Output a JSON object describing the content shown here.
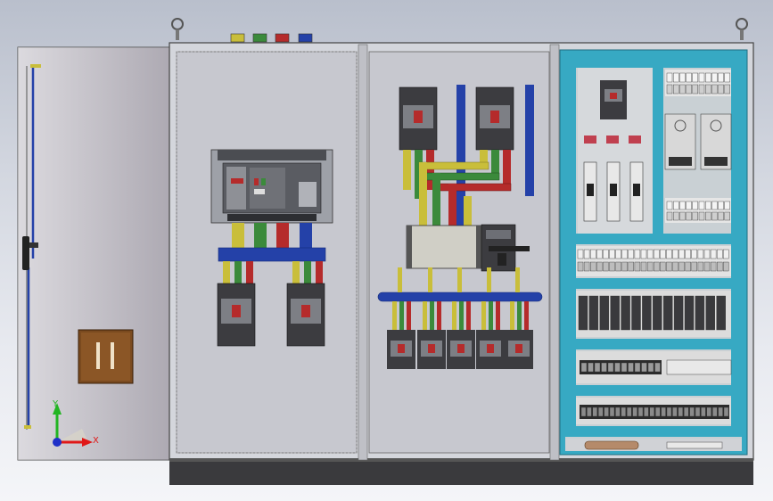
{
  "scene": {
    "breaker_label": "",
    "switch_label": "",
    "triad_labels": {
      "x": "X",
      "y": "Y"
    }
  },
  "colors": {
    "background_top": "#b9bfcc",
    "background_bottom": "#f4f5f8",
    "enclosure": "#d4d6dc",
    "panel": "#c7c8cf",
    "door": "#c4c1c9",
    "plinth": "#3a3a3d",
    "rail_cyan": "#37a9c3",
    "bus_yellow": "#c9be3a",
    "bus_green": "#3b8a3b",
    "bus_red": "#b52b2b",
    "bus_blue": "#2441a8",
    "breaker_body": "#3c3c40",
    "handle_brown": "#7a4a1f",
    "triad_x": "#e01818",
    "triad_y": "#22b522",
    "triad_z": "#1f30c8"
  },
  "icons": [
    "lifting-eye-icon",
    "door-handle-icon",
    "coordinate-triad-icon"
  ]
}
